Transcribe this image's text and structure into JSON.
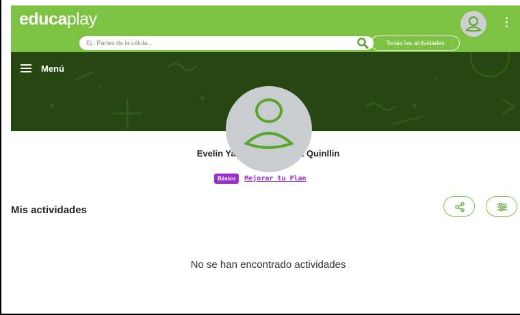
{
  "header": {
    "logo_text_a": "educa",
    "logo_text_b": "play",
    "search_placeholder": "Ej.: Partes de la célula...",
    "all_activities_label": "Todas las actividades",
    "accent_color": "#7dc242"
  },
  "banner": {
    "menu_label": "Menú",
    "background_color": "#264612"
  },
  "profile": {
    "name": "Evelin Yadira Manobanda Quinllin",
    "plan_badge": "Básico",
    "upgrade_link": "Mejorar tu Plan"
  },
  "activities": {
    "title": "Mis actividades",
    "empty_message": "No se han encontrado actividades"
  },
  "icons": {
    "avatar": "user-avatar-icon",
    "search": "search-icon",
    "kebab": "kebab-menu-icon",
    "menu": "hamburger-icon",
    "share": "share-icon",
    "filter": "sliders-icon"
  }
}
